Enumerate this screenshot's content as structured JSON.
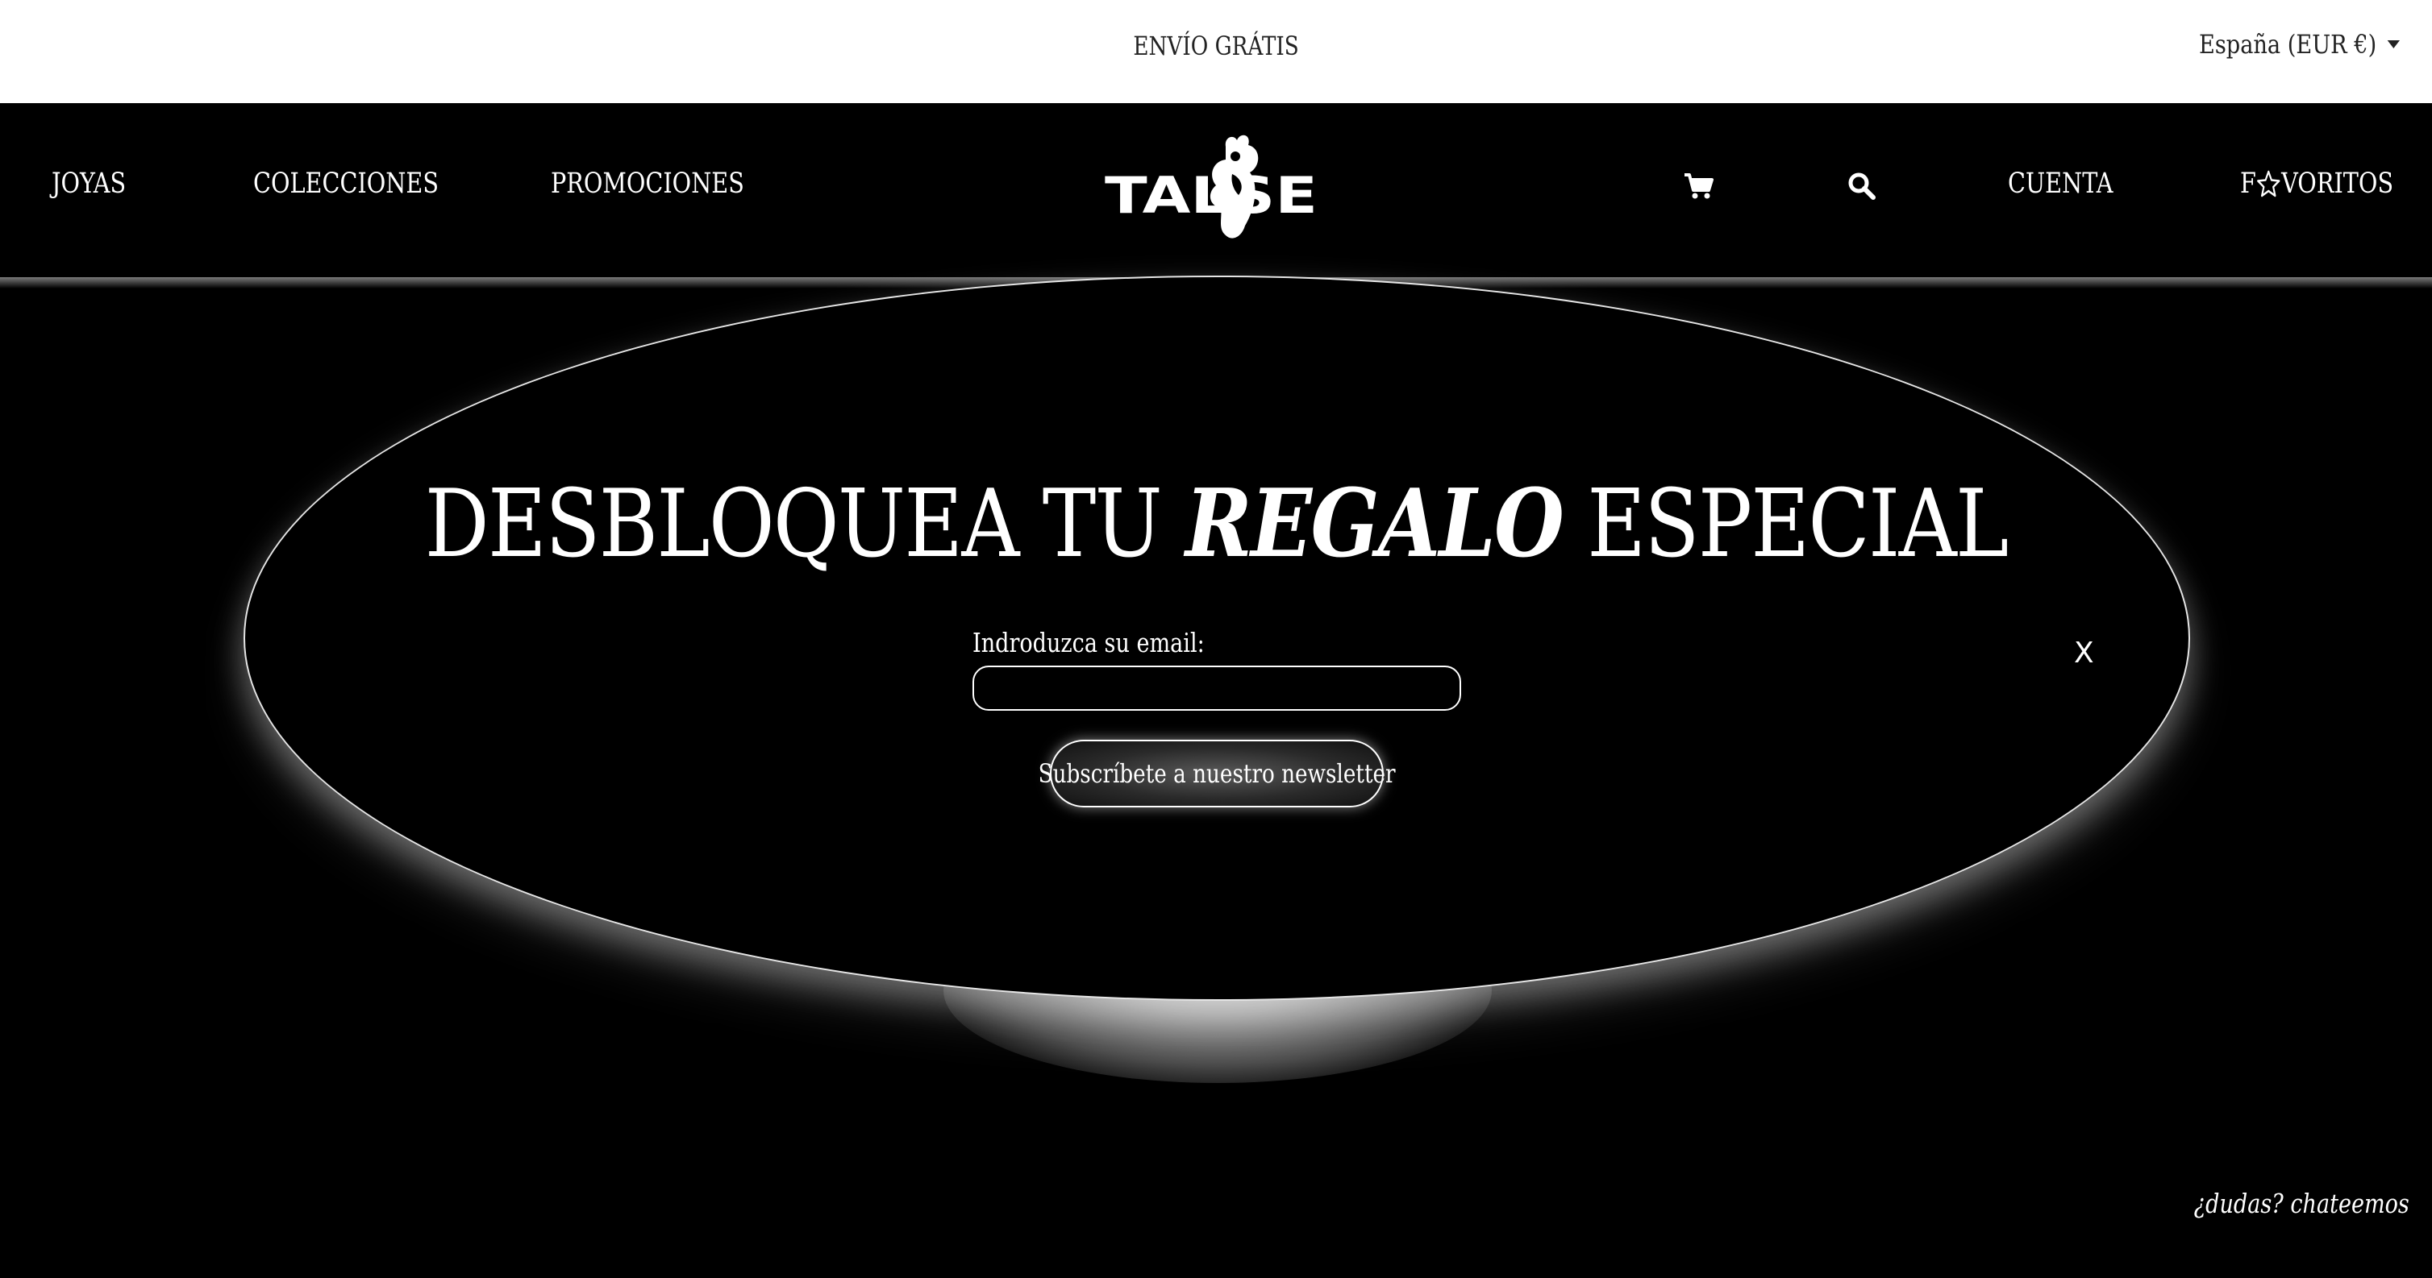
{
  "topbar": {
    "promo_text": "ENVÍO GRÁTIS",
    "region_label": "España (EUR €)"
  },
  "nav": {
    "items": [
      {
        "label": "JOYAS"
      },
      {
        "label": "COLECCIONES"
      },
      {
        "label": "PROMOCIONES"
      }
    ],
    "logo_text": "TALSE",
    "cart_icon": "cart-icon",
    "search_icon": "search-icon",
    "account_label": "CUENTA",
    "favorites_prefix": "F",
    "favorites_suffix": "VORITOS",
    "favorites_icon": "star-outline-icon"
  },
  "popup": {
    "headline_pre": "DESBLOQUEA TU ",
    "headline_emphasis": "REGALO",
    "headline_post": " ESPECIAL",
    "email_label": "Indroduzca su email:",
    "email_value": "",
    "subscribe_label": "Subscríbete a nuestro newsletter",
    "close_label": "X"
  },
  "chat_link": "¿dudas? chateemos",
  "colors": {
    "background": "#000000",
    "topbar_background": "#ffffff",
    "text_light": "#ffffff",
    "text_dark": "#222222"
  }
}
